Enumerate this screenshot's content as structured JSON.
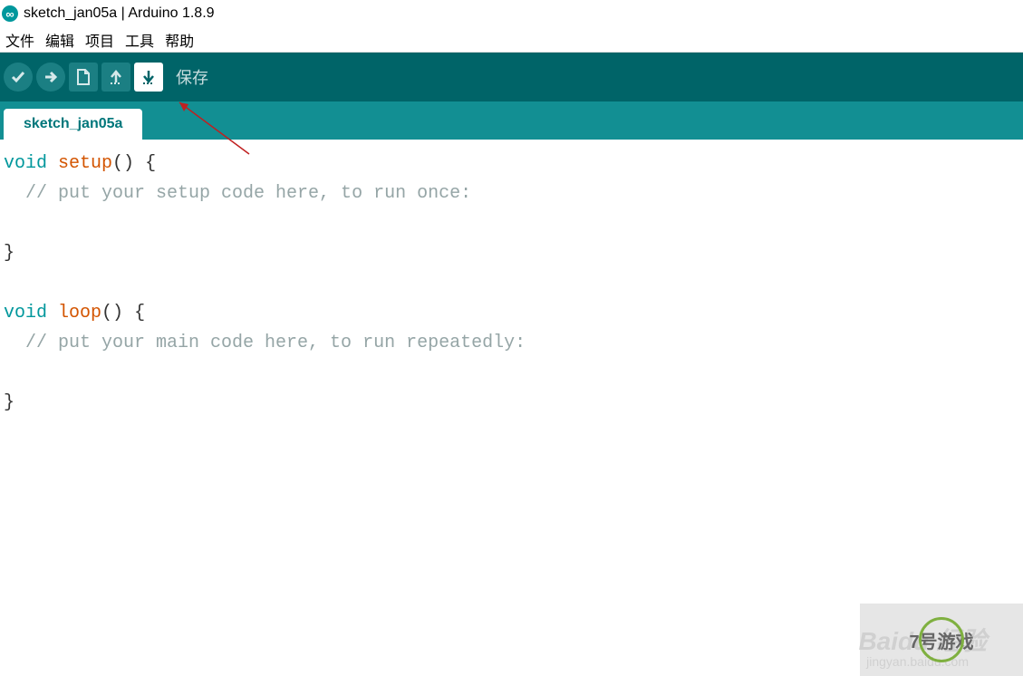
{
  "window": {
    "title": "sketch_jan05a | Arduino 1.8.9"
  },
  "menu": {
    "file": "文件",
    "edit": "编辑",
    "sketch": "项目",
    "tools": "工具",
    "help": "帮助"
  },
  "toolbar": {
    "tooltip": "保存"
  },
  "tabs": {
    "active": "sketch_jan05a"
  },
  "code": {
    "kw_void1": "void",
    "fn_setup": "setup",
    "paren1": "()",
    "brace1": " {",
    "comment1": "  // put your setup code here, to run once:",
    "brace1c": "}",
    "kw_void2": "void",
    "fn_loop": "loop",
    "paren2": "()",
    "brace2": " {",
    "comment2": "  // put your main code here, to run repeatedly:",
    "brace2c": "}"
  },
  "watermark": {
    "main": "Baidu 经验",
    "sub": "jingyan.baidu.com",
    "badge": "7号游戏",
    "badge_url": ".com"
  }
}
